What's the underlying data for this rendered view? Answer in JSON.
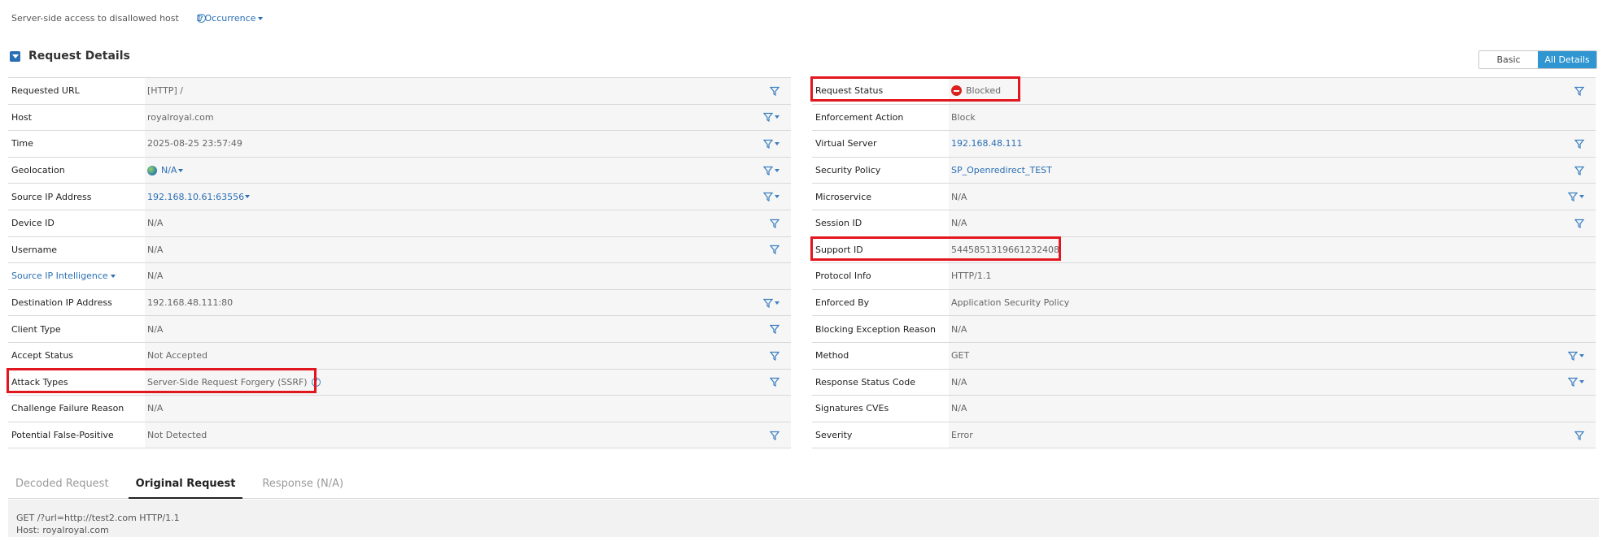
{
  "header": {
    "violation": "Server-side access to disallowed host",
    "occurrences": "1 Occurrence"
  },
  "section": {
    "title": "Request Details",
    "toggle_basic": "Basic",
    "toggle_all": "All Details"
  },
  "left_rows": [
    {
      "label": "Requested URL",
      "value": "[HTTP] /"
    },
    {
      "label": "Host",
      "value": "royalroyal.com"
    },
    {
      "label": "Time",
      "value": "2025-08-25 23:57:49"
    },
    {
      "label": "Geolocation",
      "value": "N/A"
    },
    {
      "label": "Source IP Address",
      "value": "192.168.10.61:63556"
    },
    {
      "label": "Device ID",
      "value": "N/A"
    },
    {
      "label": "Username",
      "value": "N/A"
    },
    {
      "label": "Source IP Intelligence",
      "value": "N/A"
    },
    {
      "label": "Destination IP Address",
      "value": "192.168.48.111:80"
    },
    {
      "label": "Client Type",
      "value": "N/A"
    },
    {
      "label": "Accept Status",
      "value": "Not Accepted"
    },
    {
      "label": "Attack Types",
      "value": "Server-Side Request Forgery (SSRF)"
    },
    {
      "label": "Challenge Failure Reason",
      "value": "N/A"
    },
    {
      "label": "Potential False-Positive",
      "value": "Not Detected"
    }
  ],
  "right_rows": [
    {
      "label": "Request Status",
      "value": "Blocked"
    },
    {
      "label": "Enforcement Action",
      "value": "Block"
    },
    {
      "label": "Virtual Server",
      "value": "192.168.48.111"
    },
    {
      "label": "Security Policy",
      "value": "SP_Openredirect_TEST"
    },
    {
      "label": "Microservice",
      "value": "N/A"
    },
    {
      "label": "Session ID",
      "value": "N/A"
    },
    {
      "label": "Support ID",
      "value": "5445851319661232408"
    },
    {
      "label": "Protocol Info",
      "value": "HTTP/1.1"
    },
    {
      "label": "Enforced By",
      "value": "Application Security Policy"
    },
    {
      "label": "Blocking Exception Reason",
      "value": "N/A"
    },
    {
      "label": "Method",
      "value": "GET"
    },
    {
      "label": "Response Status Code",
      "value": "N/A"
    },
    {
      "label": "Signatures CVEs",
      "value": "N/A"
    },
    {
      "label": "Severity",
      "value": "Error"
    }
  ],
  "tabs": [
    "Decoded Request",
    "Original Request",
    "Response (N/A)"
  ],
  "request_text": {
    "line1": "GET /?url=http://test2.com HTTP/1.1",
    "line2": "Host: royalroyal.com"
  },
  "colors": {
    "link": "#2a6fb3",
    "highlight": "#e2161f",
    "toggle_active": "#2f96d2"
  }
}
